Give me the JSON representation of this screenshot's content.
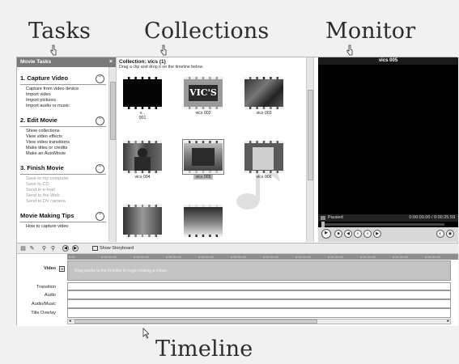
{
  "labels": {
    "tasks": "Tasks",
    "collections": "Collections",
    "monitor": "Monitor",
    "timeline": "Timeline"
  },
  "tasks_pane": {
    "header": "Movie Tasks",
    "close": "×",
    "sections": [
      {
        "title": "1. Capture Video",
        "items": [
          "Capture from video device",
          "Import video",
          "Import pictures",
          "Import audio or music"
        ],
        "dim": false
      },
      {
        "title": "2. Edit Movie",
        "items": [
          "Show collections",
          "View video effects",
          "View video transitions",
          "Make titles or credits",
          "Make an AutoMovie"
        ],
        "dim": false
      },
      {
        "title": "3. Finish Movie",
        "items": [
          "Save to my computer",
          "Save to CD",
          "Send in e-mail",
          "Send to the Web",
          "Send to DV camera"
        ],
        "dim": true
      },
      {
        "title": "Movie Making Tips",
        "items": [
          "How to capture video"
        ],
        "dim": false
      }
    ]
  },
  "collection": {
    "title": "Collection: vics (1)",
    "subtitle": "Drag a clip and drop it on the timeline below.",
    "clips": [
      {
        "caption": "v...\n001",
        "selected": false
      },
      {
        "caption": "vics 002",
        "selected": false
      },
      {
        "caption": "vics 003",
        "selected": false
      },
      {
        "caption": "vics 004",
        "selected": false
      },
      {
        "caption": "vics 005",
        "selected": true
      },
      {
        "caption": "vics 006",
        "selected": false
      },
      {
        "caption": "",
        "selected": false
      },
      {
        "caption": "",
        "selected": false
      }
    ],
    "clip2_sign": "VIC'S"
  },
  "monitor": {
    "title": "vics 005",
    "status": "Paused",
    "time": "0:00:00.00 / 0:00:25.59"
  },
  "timeline": {
    "show_storyboard": "Show Storyboard",
    "tracks": [
      "Video",
      "Transition",
      "Audio",
      "Audio/Music",
      "Title Overlay"
    ],
    "drop_hint": "Drag media to the timeline to begin making a movie.",
    "ruler_ticks": [
      "0:00",
      "0:00:10.00",
      "0:00:20.00",
      "0:00:30.00",
      "0:00:40.00",
      "0:00:50.00",
      "0:01:00.00",
      "0:01:10.00",
      "0:01:20.00",
      "0:01:30.00",
      "0:01:40.00",
      "0:01:50.00"
    ]
  }
}
